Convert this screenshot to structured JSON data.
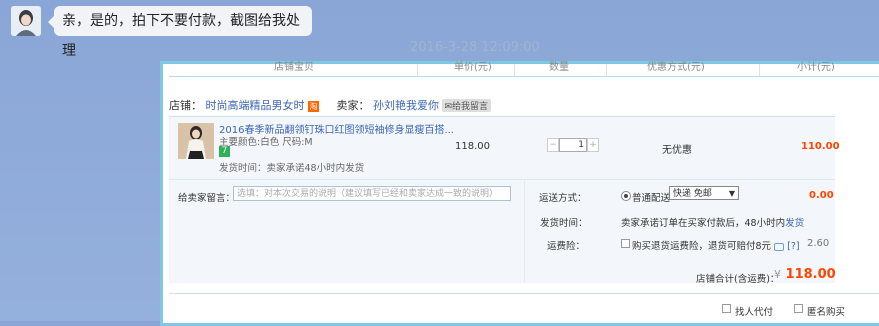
{
  "chat": {
    "message": "亲，是的，拍下不要付款，截图给我处理",
    "timestamp": "2016-3-28 12:09:00"
  },
  "order": {
    "headers": [
      "店铺宝贝",
      "单价(元)",
      "数量",
      "优惠方式(元)",
      "小计(元)"
    ],
    "shop_label": "店铺：",
    "shop_name": "时尚高端精品男女时",
    "seller_label": "卖家：",
    "seller_name": "孙刘艳我爱你",
    "msg_btn": "给我留言",
    "item": {
      "title": "2016春季新品翻领钉珠口红图领短袖修身显瘦百搭...",
      "spec": "主要颜色:白色  尺码:M",
      "tag": "7",
      "ship_time": "发货时间：卖家承诺48小时内发货",
      "price": "118.00",
      "qty": "1",
      "discount": "无优惠",
      "subtotal": "110.00"
    },
    "memo_label": "给卖家留言：",
    "memo_placeholder": "选填：对本次交易的说明（建议填写已经和卖家达成一致的说明）",
    "ship_method_label": "运送方式：",
    "ship_option": "普通配送",
    "ship_select": "快递 免邮",
    "ship_fee": "0.00",
    "delivery_label": "发货时间：",
    "delivery_text": "卖家承诺订单在买家付款后，48小时内",
    "delivery_link": "发货",
    "insurance_label": "运费险：",
    "insurance_text": "购买退货运费险，退货可赔付8元",
    "insurance_help": "[?]",
    "insurance_fee": "2.60",
    "total_label": "店铺合计(含运费)：",
    "total_currency": "¥",
    "total_value": "118.00",
    "option_proxy": "找人代付",
    "option_anonymous": "匿名购买"
  }
}
